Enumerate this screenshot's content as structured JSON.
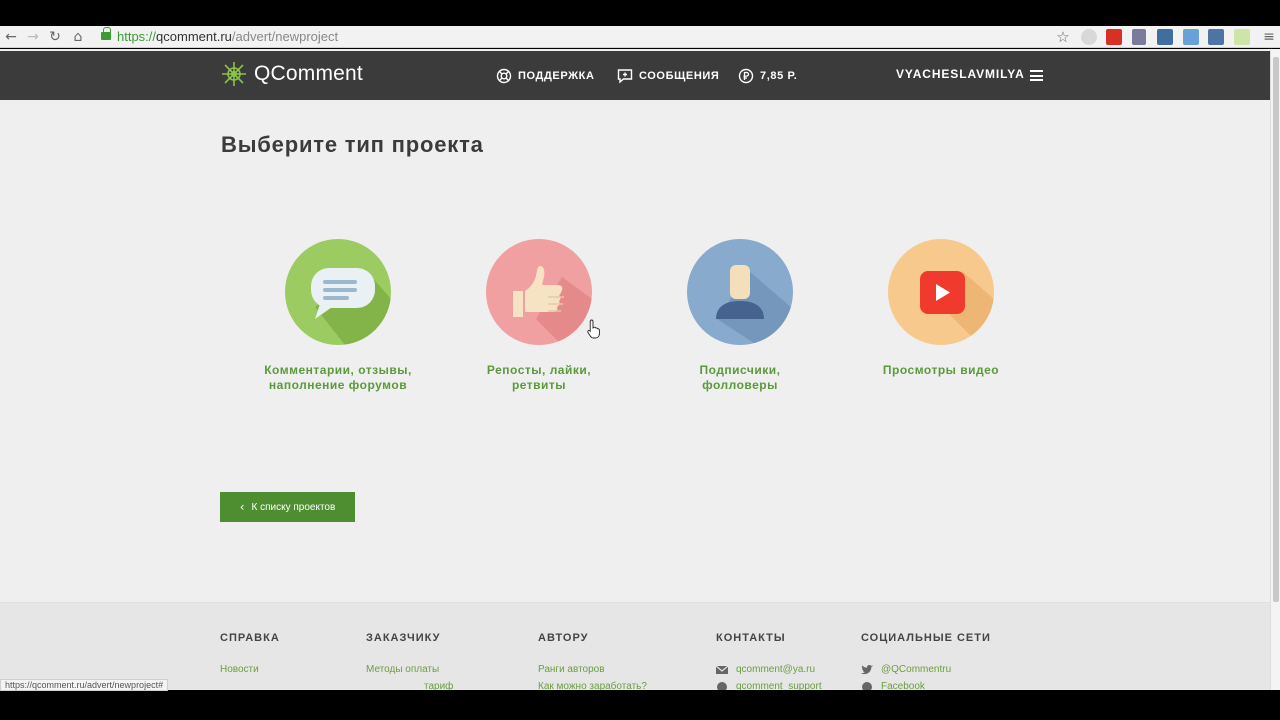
{
  "browser": {
    "url_scheme": "https://",
    "url_host": "qcomment.ru",
    "url_path": "/advert/newproject"
  },
  "header": {
    "logo_text": "QComment",
    "support": "ПОДДЕРЖКА",
    "messages": "СООБЩЕНИЯ",
    "balance": "7,85 Р.",
    "username": "VYACHESLAVMILYA"
  },
  "main": {
    "title": "Выберите тип проекта",
    "project_types": [
      {
        "label": "Комментарии, отзывы, наполнение форумов",
        "icon": "comment-icon",
        "color": "#9ccb62"
      },
      {
        "label": "Репосты, лайки, ретвиты",
        "icon": "thumbs-up-icon",
        "color": "#f0a0a0"
      },
      {
        "label": "Подписчики, фолловеры",
        "icon": "user-icon",
        "color": "#88aacc"
      },
      {
        "label": "Просмотры видео",
        "icon": "video-play-icon",
        "color": "#f7c98c"
      }
    ],
    "back_button": "К списку проектов"
  },
  "footer": {
    "columns": [
      {
        "heading": "СПРАВКА",
        "links": [
          "Новости"
        ]
      },
      {
        "heading": "ЗАКАЗЧИКУ",
        "links": [
          "Методы оплаты",
          "тариф"
        ]
      },
      {
        "heading": "АВТОРУ",
        "links": [
          "Ранги авторов",
          "Как можно заработать?"
        ]
      },
      {
        "heading": "КОНТАКТЫ",
        "links": [
          "qcomment@ya.ru",
          "qcomment_support"
        ]
      },
      {
        "heading": "СОЦИАЛЬНЫЕ СЕТИ",
        "links": [
          "@QCommentru",
          "Facebook"
        ]
      }
    ]
  },
  "status_bar": "https://qcomment.ru/advert/newproject#"
}
